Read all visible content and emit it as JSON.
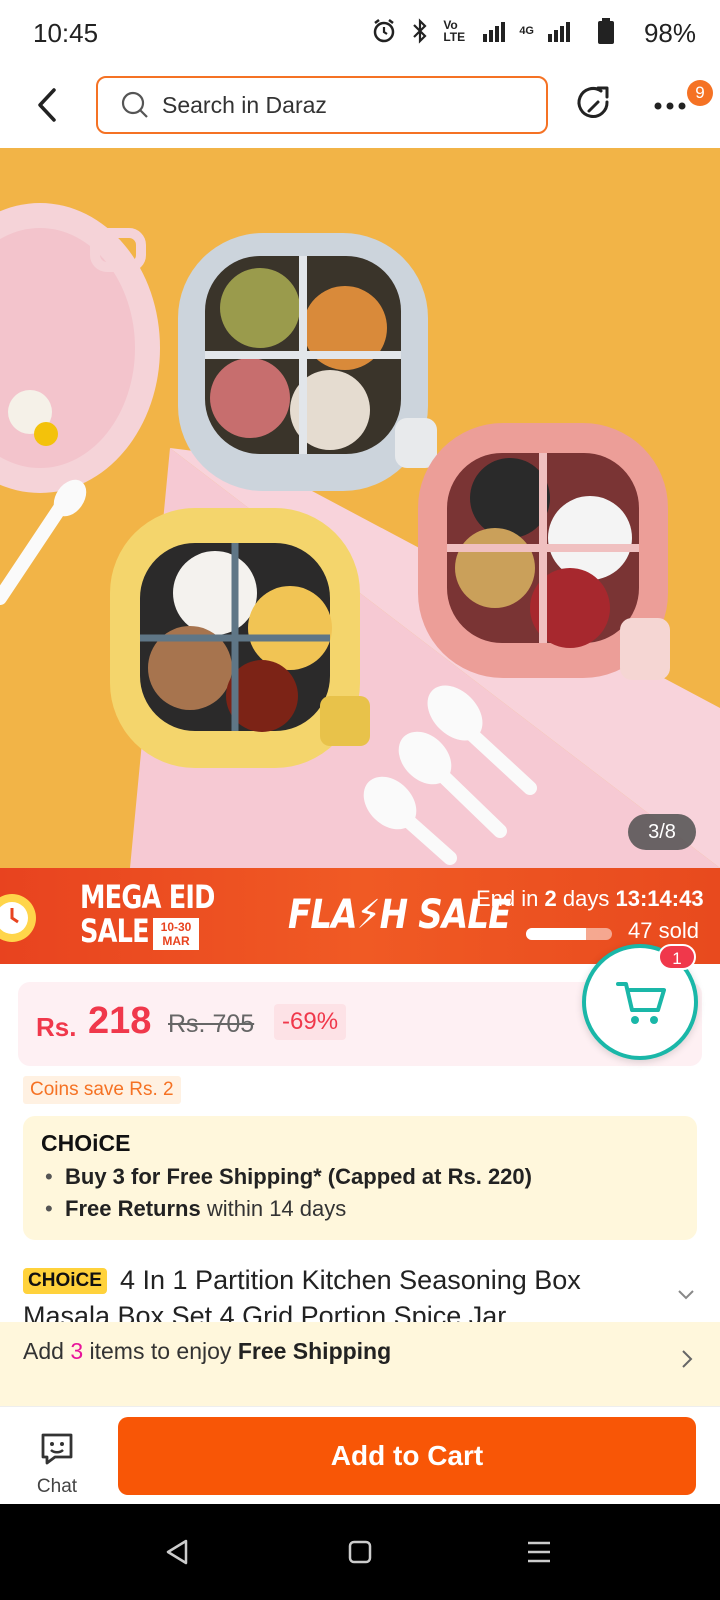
{
  "status_bar": {
    "time": "10:45",
    "network_label": "Vo LTE",
    "network_type": "4G",
    "battery_pct": "98%"
  },
  "header": {
    "search_placeholder": "Search in Daraz",
    "more_badge": "9"
  },
  "gallery": {
    "counter": "3/8"
  },
  "flash_banner": {
    "campaign_line1": "MEGA EID",
    "campaign_line2": "SALE",
    "campaign_dates": "10-30",
    "campaign_month": "MAR",
    "flash_label": "FLA⚡H SALE",
    "end_prefix": "End in",
    "end_days": "2",
    "end_days_suffix": "days",
    "end_time": "13:14:43",
    "sold": "47 sold",
    "sold_fraction": 0.7
  },
  "price": {
    "currency": "Rs.",
    "current": "218",
    "original": "Rs. 705",
    "discount": "-69%"
  },
  "cart": {
    "badge": "1"
  },
  "coins": {
    "text": "Coins save Rs. 2"
  },
  "choice": {
    "logo": "CHOiCE",
    "line1_bold": "Buy 3 for  Free Shipping* (Capped at Rs. 220)",
    "line2_bold": "Free Returns",
    "line2_rest": " within 14 days"
  },
  "product": {
    "badge": "CHOiCE",
    "title": "4 In 1 Partition Kitchen Seasoning Box Masala Box Set 4 Grid Portion Spice Jar ..."
  },
  "shipping_strip": {
    "prefix": "Add ",
    "count": "3",
    "middle": " items to enjoy ",
    "bold": "Free Shipping"
  },
  "action_bar": {
    "chat_label": "Chat",
    "add_to_cart": "Add to Cart"
  },
  "colors": {
    "brand_orange": "#f85606",
    "price_red": "#f0384b",
    "teal": "#1ab7a8",
    "choice_yellow": "#ffd23b"
  }
}
